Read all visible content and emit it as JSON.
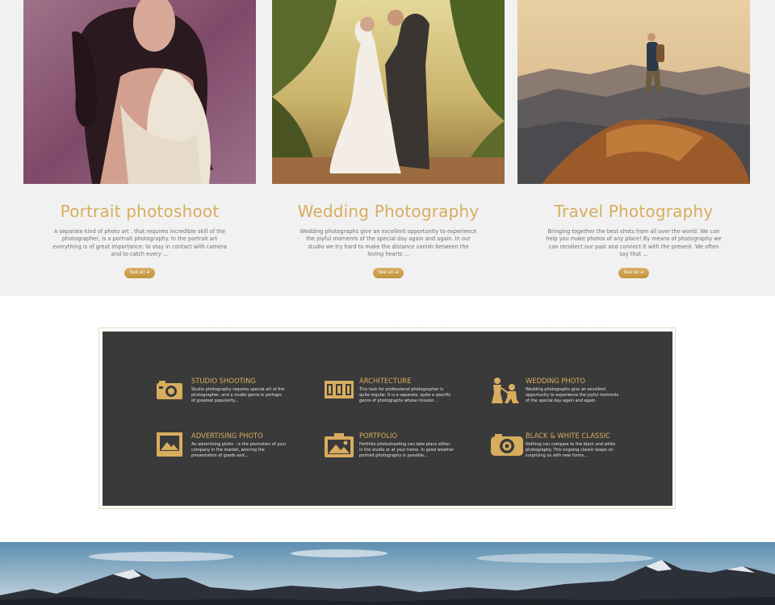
{
  "gallery": {
    "cards": [
      {
        "title": "Portrait photoshoot",
        "text": "A separate kind of photo art , that requires incredible skill of the photographer, is a portrait photography. In the portrait art everything is of great importance: to stay in contact with camera and to catch every ...",
        "button": "See all"
      },
      {
        "title": "Wedding Photography",
        "text": "Wedding photographs give an excellent opportunity to experience the joyful moments of the special day again and again. In our studio we try hard to make the distance vanish between the loving hearts ...",
        "button": "See all"
      },
      {
        "title": "Travel Photography",
        "text": "Bringing together the best shots from all over the world. We can help you make photos of any place! By means of photography we can recollect our past and connect it with the present. We often say that ...",
        "button": "See all"
      }
    ]
  },
  "services": {
    "items": [
      {
        "title": "STUDIO SHOOTING",
        "text": "Studio photography requires special art of the photographer, and a studio genre is perhaps of greatest popularity...",
        "icon": "camera-icon"
      },
      {
        "title": "ARCHITECTURE",
        "text": "This task for professional photographer is quite regular. It is a separate, quite a specific genre of photographs whose mission...",
        "icon": "film-strip-icon"
      },
      {
        "title": "WEDDING PHOTO",
        "text": "Wedding photographs give an excellent opportunity to experience the joyful moments of the special day again and again.",
        "icon": "couple-icon"
      },
      {
        "title": "ADVERTISING PHOTO",
        "text": "An advertising photo - is the promotion of your company in the market, winning the presentation of goods and...",
        "icon": "picture-frame-icon"
      },
      {
        "title": "PORTFOLIO",
        "text": "Portfolio photoshooting can take place either in the studio or at your home. In good weather portrait photography is possible...",
        "icon": "photo-camera-icon"
      },
      {
        "title": "BLACK & WHITE CLASSIC",
        "text": "Nothing can compare to the black and white photography. This ongoing classic keeps on surprising us with new forms...",
        "icon": "retro-camera-icon"
      }
    ]
  },
  "colors": {
    "accent": "#d8ad5e",
    "panel": "#3a3a3a",
    "gallery_bg": "#f1f1f1",
    "text_gray": "#6f6f6f"
  }
}
